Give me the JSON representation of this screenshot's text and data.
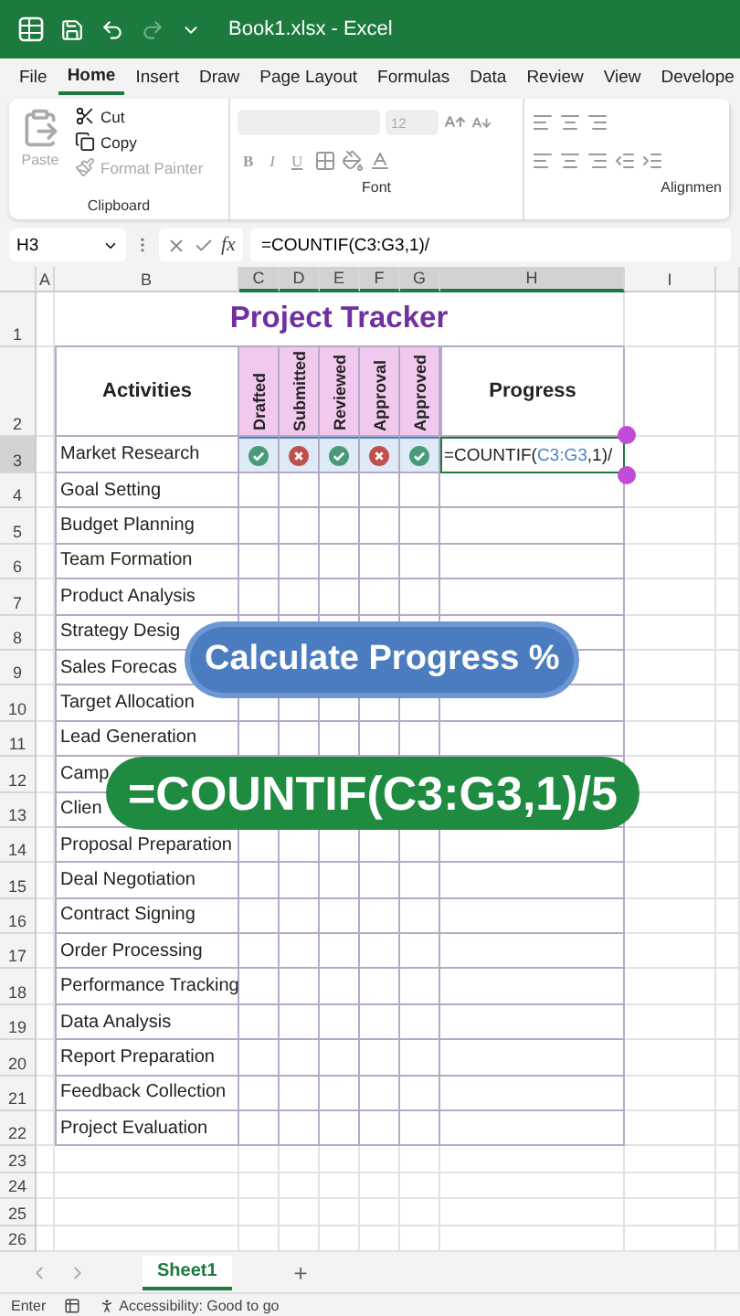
{
  "title_bar": {
    "title": "Book1.xlsx - Excel"
  },
  "ribbon_tabs": [
    {
      "label": "File",
      "selected": false
    },
    {
      "label": "Home",
      "selected": true
    },
    {
      "label": "Insert",
      "selected": false
    },
    {
      "label": "Draw",
      "selected": false
    },
    {
      "label": "Page Layout",
      "selected": false
    },
    {
      "label": "Formulas",
      "selected": false
    },
    {
      "label": "Data",
      "selected": false
    },
    {
      "label": "Review",
      "selected": false
    },
    {
      "label": "View",
      "selected": false
    },
    {
      "label": "Develope",
      "selected": false
    }
  ],
  "clipboard": {
    "label": "Clipboard",
    "items": [
      {
        "kind": "paste",
        "label": "Paste",
        "disabled": true
      },
      {
        "kind": "cut",
        "label": "Cut",
        "disabled": false
      },
      {
        "kind": "copy",
        "label": "Copy",
        "disabled": false
      },
      {
        "kind": "painter",
        "label": "Format Painter",
        "disabled": true
      }
    ]
  },
  "font": {
    "label": "Font",
    "size": "12",
    "styles": [
      "B",
      "I",
      "U"
    ]
  },
  "alignment": {
    "label": "Alignmen"
  },
  "formula_bar": {
    "name_box": "H3",
    "function_label": "fx",
    "formula": "=COUNTIF(C3:G3,1)/"
  },
  "columns": [
    "A",
    "B",
    "C",
    "D",
    "E",
    "F",
    "G",
    "H",
    "I"
  ],
  "sheet": {
    "title_row": "1",
    "title": "Project Tracker",
    "header_row": "2",
    "activities_header": "Activities",
    "stages": [
      "Drafted",
      "Submitted",
      "Reviewed",
      "Approval",
      "Approved"
    ],
    "progress_header": "Progress",
    "rows": [
      {
        "row": "3",
        "activity": "Market Research",
        "statuses": [
          {
            "checked": true
          },
          {
            "checked": false
          },
          {
            "checked": true
          },
          {
            "checked": false
          },
          {
            "checked": true
          }
        ],
        "progress_parts": [
          {
            "kind": "plain",
            "text": "=COUNTIF("
          },
          {
            "kind": "reference",
            "text": "C3:G3"
          },
          {
            "kind": "plain",
            "text": ",1)/"
          }
        ]
      },
      {
        "row": "4",
        "activity": "Goal Setting"
      },
      {
        "row": "5",
        "activity": "Budget Planning"
      },
      {
        "row": "6",
        "activity": "Team Formation"
      },
      {
        "row": "7",
        "activity": "Product Analysis"
      },
      {
        "row": "8",
        "activity": "Strategy Desig"
      },
      {
        "row": "9",
        "activity": "Sales Forecas"
      },
      {
        "row": "10",
        "activity": "Target Allocation"
      },
      {
        "row": "11",
        "activity": "Lead Generation"
      },
      {
        "row": "12",
        "activity": "Camp"
      },
      {
        "row": "13",
        "activity": "Clien"
      },
      {
        "row": "14",
        "activity": "Proposal Preparation"
      },
      {
        "row": "15",
        "activity": "Deal Negotiation"
      },
      {
        "row": "16",
        "activity": "Contract Signing"
      },
      {
        "row": "17",
        "activity": "Order Processing"
      },
      {
        "row": "18",
        "activity": "Performance Tracking"
      },
      {
        "row": "19",
        "activity": "Data Analysis"
      },
      {
        "row": "20",
        "activity": "Report Preparation"
      },
      {
        "row": "21",
        "activity": "Feedback Collection"
      },
      {
        "row": "22",
        "activity": "Project Evaluation"
      }
    ],
    "empty_rows": [
      "23",
      "24",
      "25",
      "26"
    ]
  },
  "overlays": [
    {
      "kind": "caption",
      "text": "Calculate Progress %"
    },
    {
      "kind": "formula",
      "text": "=COUNTIF(C3:G3,1)/5"
    }
  ],
  "sheet_tabs": [
    {
      "label": "Sheet1",
      "selected": true
    }
  ],
  "add_sheet": "+",
  "status_bar": {
    "mode": "Enter",
    "accessibility": "Accessibility: Good to go"
  }
}
